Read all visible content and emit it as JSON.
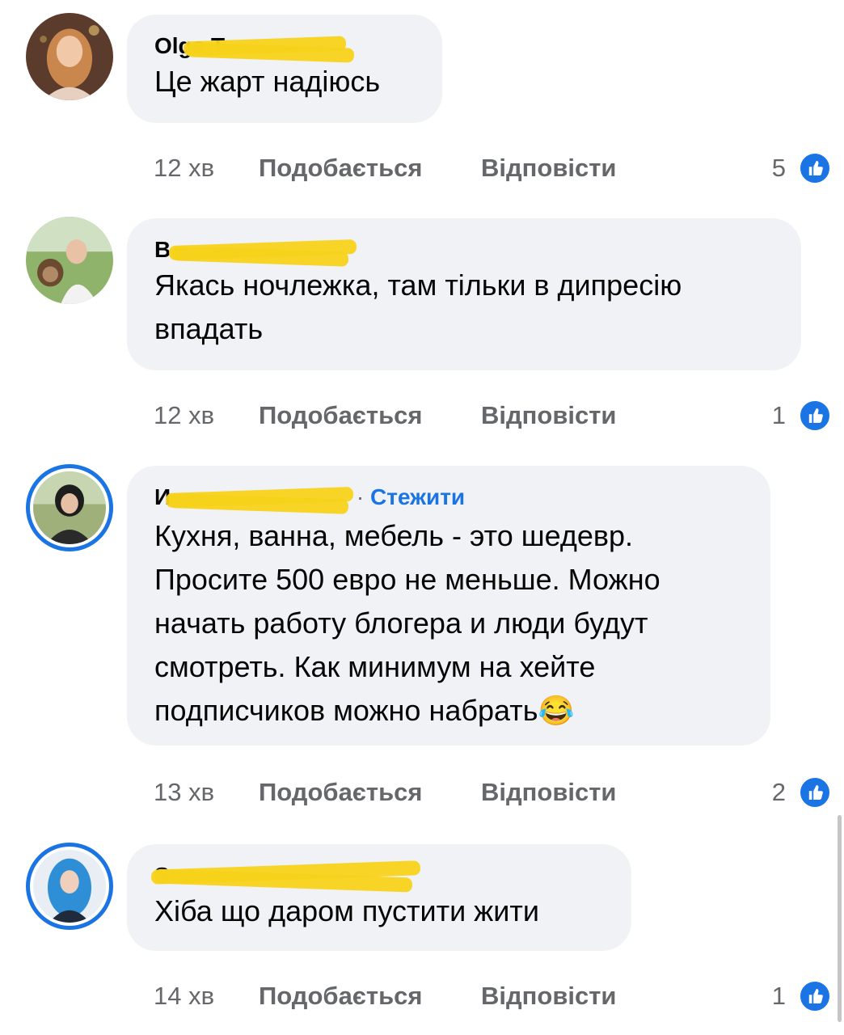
{
  "comments": [
    {
      "name": "Olga T",
      "text": "Це жарт надіюсь",
      "time": "12 хв",
      "like_label": "Подобається",
      "reply_label": "Відповісти",
      "reactions": "5",
      "follow": null
    },
    {
      "name": "В",
      "text": "Якась ночлежка, там тільки в  дипресію впадать",
      "time": "12 хв",
      "like_label": "Подобається",
      "reply_label": "Відповісти",
      "reactions": "1",
      "follow": null
    },
    {
      "name": "И",
      "text": "Кухня, ванна, мебель - это шедевр. Просите 500 евро не меньше. Можно начать работу блогера и люди будут смотреть. Как минимум на хейте подписчиков можно набрать😂",
      "time": "13 хв",
      "like_label": "Подобається",
      "reply_label": "Відповісти",
      "reactions": "2",
      "follow": "Стежити"
    },
    {
      "name": "S",
      "text": "Хіба що даром пустити жити",
      "time": "14 хв",
      "like_label": "Подобається",
      "reply_label": "Відповісти",
      "reactions": "1",
      "follow": null
    }
  ],
  "colors": {
    "accent": "#1b74e4",
    "bubble": "#f0f2f5",
    "redaction": "#f7d21a",
    "meta_text": "#65676b"
  },
  "icons": {
    "reaction": "like-thumb-icon"
  }
}
